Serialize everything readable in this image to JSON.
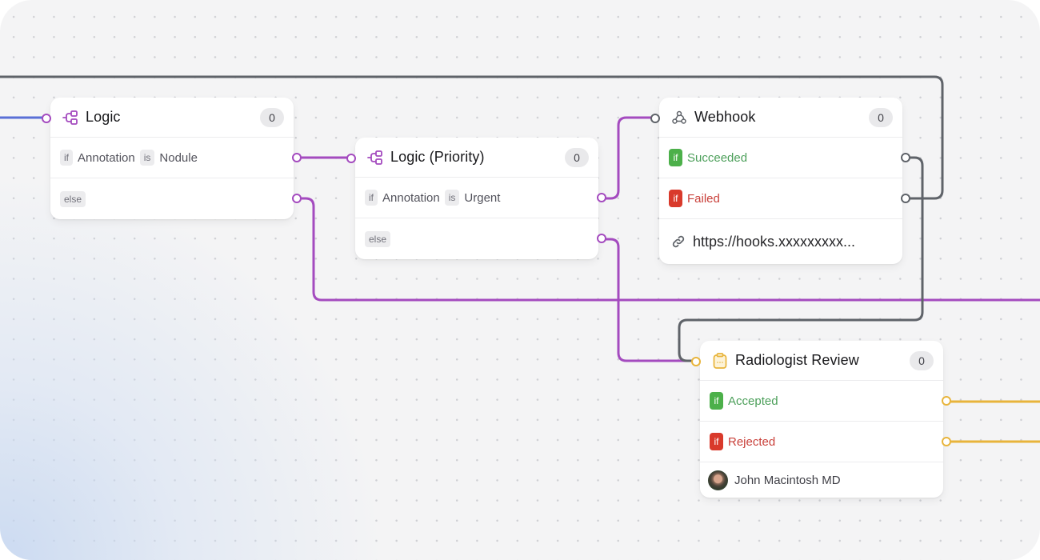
{
  "canvas": {
    "colors": {
      "logic": "#a44bbf",
      "webhook": "#5f6369",
      "review": "#e8b43b",
      "incoming": "#5a6fd6",
      "success": "#4cb04a",
      "failure": "#d93a2b"
    }
  },
  "nodes": {
    "logic": {
      "icon": "logic-branch-icon",
      "title": "Logic",
      "count": "0",
      "rows": [
        {
          "prefix": "if",
          "field": "Annotation",
          "op": "is",
          "value": "Nodule"
        },
        {
          "prefix": "else"
        }
      ]
    },
    "logic_priority": {
      "icon": "logic-branch-icon",
      "title": "Logic (Priority)",
      "count": "0",
      "rows": [
        {
          "prefix": "if",
          "field": "Annotation",
          "op": "is",
          "value": "Urgent"
        },
        {
          "prefix": "else"
        }
      ]
    },
    "webhook": {
      "icon": "webhook-icon",
      "title": "Webhook",
      "count": "0",
      "rows": [
        {
          "badge": "if",
          "label": "Succeeded",
          "status": "success"
        },
        {
          "badge": "if",
          "label": "Failed",
          "status": "failure"
        }
      ],
      "url_icon": "link-icon",
      "url": "https://hooks.xxxxxxxxx..."
    },
    "radiologist_review": {
      "icon": "clipboard-icon",
      "title": "Radiologist Review",
      "count": "0",
      "rows": [
        {
          "badge": "if",
          "label": "Accepted",
          "status": "success"
        },
        {
          "badge": "if",
          "label": "Rejected",
          "status": "failure"
        }
      ],
      "assignee": "John Macintosh MD"
    }
  }
}
